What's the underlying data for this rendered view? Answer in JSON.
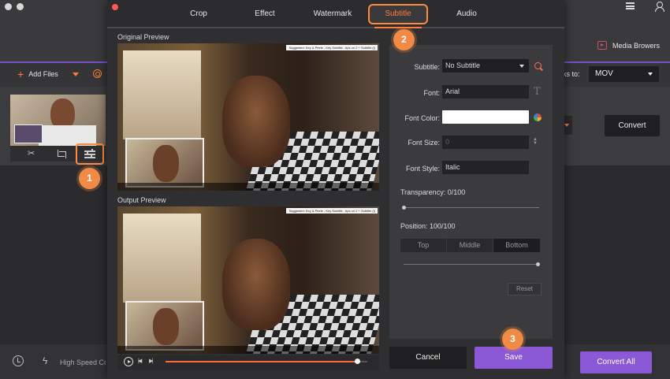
{
  "app": {
    "media_browsers": "Media Browers",
    "add_files": "Add Files",
    "convert_to_label": "ks to:",
    "format_value": "MOV",
    "convert_button": "Convert",
    "high_speed": "High Speed Co",
    "convert_all_button": "Convert All"
  },
  "dialog": {
    "tabs": [
      "Crop",
      "Effect",
      "Watermark",
      "Subtitle",
      "Audio"
    ],
    "active_tab": "Subtitle",
    "original_preview_label": "Original Preview",
    "output_preview_label": "Output Preview",
    "preview_banner": "Suggested: Key & Peele - Key Subtitle - tips on 2 + Subtitle (i)",
    "player": {
      "prev": "|◀",
      "next": "▶|",
      "progress": 0.95
    },
    "settings": {
      "subtitle_label": "Subtitle:",
      "subtitle_value": "No Subtitle",
      "font_label": "Font:",
      "font_value": "Arial",
      "font_color_label": "Font Color:",
      "font_color_value": "#FFFFFF",
      "font_size_label": "Font Size:",
      "font_size_value": "0",
      "font_style_label": "Font Style:",
      "font_style_value": "Italic",
      "transparency_label": "Transparency: 0/100",
      "transparency_value": 0,
      "position_label": "Position: 100/100",
      "position_value": 100,
      "position_options": [
        "Top",
        "Middle",
        "Bottom"
      ],
      "position_selected": "Bottom",
      "reset_button": "Reset"
    },
    "cancel_button": "Cancel",
    "save_button": "Save"
  },
  "callouts": [
    "1",
    "2",
    "3"
  ],
  "colors": {
    "accent_orange": "#FF7A3D",
    "accent_purple": "#8B58D6",
    "close_red": "#FF5A52"
  }
}
